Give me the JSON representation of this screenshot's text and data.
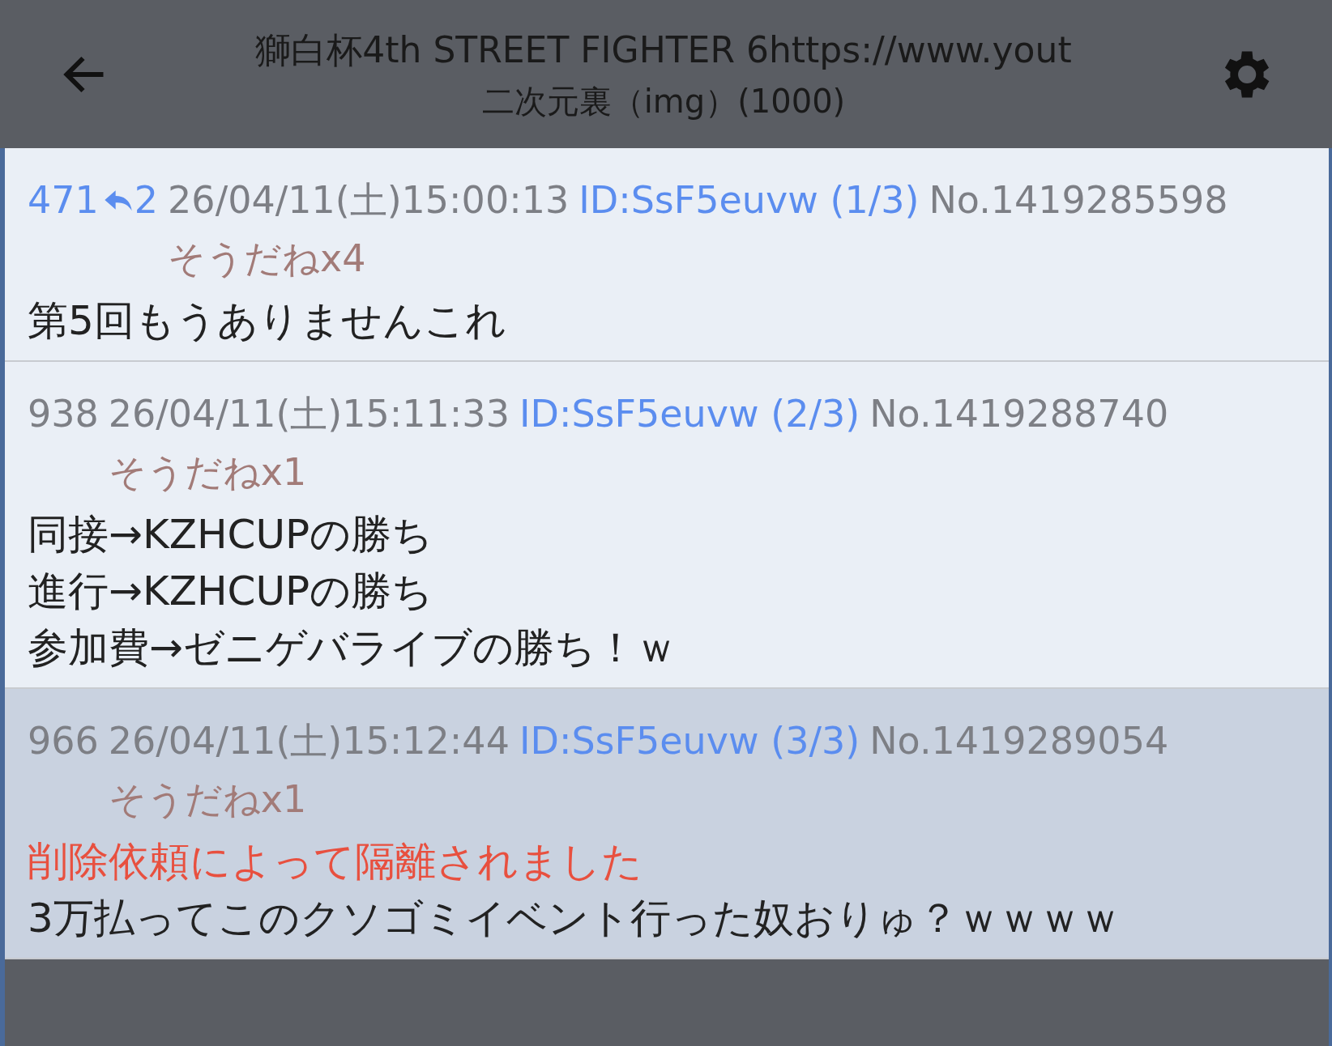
{
  "header": {
    "title": "獅白杯4th STREET FIGHTER 6https://www.yout",
    "subtitle": "二次元裏（img）(1000)"
  },
  "posts": [
    {
      "number": "471",
      "replies": "2",
      "date": "26/04/11(土)15:00:13",
      "id": "ID:SsF5euvw (1/3)",
      "no": "No.1419285598",
      "sodane": "そうだねx4",
      "selected": false,
      "lines": [
        {
          "kind": "text",
          "text": "第5回もうありませんこれ"
        }
      ]
    },
    {
      "number": "938",
      "date": "26/04/11(土)15:11:33",
      "id": "ID:SsF5euvw (2/3)",
      "no": "No.1419288740",
      "sodane": "そうだねx1",
      "selected": false,
      "lines": [
        {
          "kind": "text",
          "text": "同接→KZHCUPの勝ち"
        },
        {
          "kind": "text",
          "text": "進行→KZHCUPの勝ち"
        },
        {
          "kind": "text",
          "text": "参加費→ゼニゲバライブの勝ち！ｗ"
        }
      ]
    },
    {
      "number": "966",
      "date": "26/04/11(土)15:12:44",
      "id": "ID:SsF5euvw (3/3)",
      "no": "No.1419289054",
      "sodane": "そうだねx1",
      "selected": true,
      "lines": [
        {
          "kind": "warning",
          "text": "削除依頼によって隔離されました"
        },
        {
          "kind": "text",
          "text": "3万払ってこのクソゴミイベント行った奴おりゅ？ｗｗｗｗ"
        }
      ]
    }
  ]
}
